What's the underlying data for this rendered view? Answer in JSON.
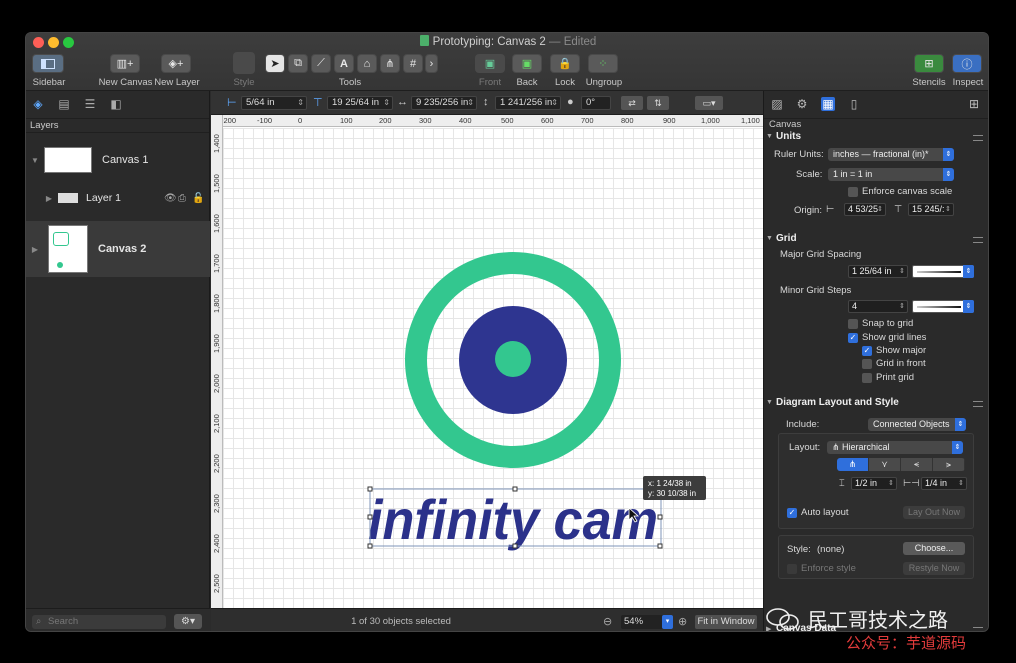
{
  "window": {
    "title": "Prototyping: Canvas 2",
    "edited": "— Edited"
  },
  "toolbar": {
    "sidebar_label": "Sidebar",
    "new_canvas_label": "New Canvas",
    "new_layer_label": "New Layer",
    "style_label": "Style",
    "tools_label": "Tools",
    "front_label": "Front",
    "back_label": "Back",
    "lock_label": "Lock",
    "ungroup_label": "Ungroup",
    "stencils_label": "Stencils",
    "inspect_label": "Inspect",
    "text_tool": "A"
  },
  "sidebar": {
    "header": "Layers",
    "canvas1": "Canvas 1",
    "layer1": "Layer 1",
    "canvas2": "Canvas 2",
    "search_placeholder": "Search"
  },
  "controls": {
    "x": "5/64 in",
    "y": "19 25/64 in",
    "width": "9 235/256 in",
    "height": "1 241/256 in",
    "angle": "0°"
  },
  "ruler": {
    "h": [
      "-200",
      "-100",
      "0",
      "100",
      "200",
      "300",
      "400",
      "500",
      "600",
      "700",
      "800",
      "900",
      "1,000",
      "1,100"
    ],
    "v": [
      "1,400",
      "1,500",
      "1,600",
      "1,700",
      "1,800",
      "1,900",
      "2,000",
      "2,100",
      "2,200",
      "2,300",
      "2,400",
      "2,500"
    ]
  },
  "canvas": {
    "logo_text": "infinity cam",
    "tooltip_x": "x: 1 24/38 in",
    "tooltip_y": "y: 30 10/38 in",
    "colors": {
      "ring": "#33c78f",
      "core": "#2e3590",
      "dot": "#33c78f",
      "text": "#2b318a"
    }
  },
  "status": {
    "message": "1 of 30 objects selected",
    "zoom": "54%",
    "fit_label": "Fit in Window"
  },
  "inspector": {
    "title": "Canvas",
    "units": {
      "header": "Units",
      "ruler_units_label": "Ruler Units:",
      "ruler_units_value": "inches — fractional (in)*",
      "scale_label": "Scale:",
      "scale_value": "1 in = 1 in",
      "enforce_label": "Enforce canvas scale",
      "origin_label": "Origin:",
      "origin_x": "4 53/25",
      "origin_y": "15 245/:"
    },
    "grid": {
      "header": "Grid",
      "major_label": "Major Grid Spacing",
      "major_value": "1 25/64 in",
      "minor_label": "Minor Grid Steps",
      "minor_value": "4",
      "snap": "Snap to grid",
      "show_lines": "Show grid lines",
      "show_major": "Show major",
      "in_front": "Grid in front",
      "print": "Print grid"
    },
    "layout": {
      "header": "Diagram Layout and Style",
      "include_label": "Include:",
      "include_value": "Connected Objects",
      "layout_label": "Layout:",
      "layout_value": "Hierarchical",
      "rank_sep": "1/2 in",
      "obj_sep": "1/4 in",
      "auto_layout": "Auto layout",
      "lay_out_now": "Lay Out Now",
      "style_label": "Style:",
      "style_value": "(none)",
      "choose": "Choose...",
      "enforce_style": "Enforce style",
      "restyle_now": "Restyle Now"
    },
    "canvas_data": {
      "header": "Canvas Data"
    }
  },
  "watermark": {
    "line1": "民工哥技术之路",
    "line2": "公众号：芋道源码"
  }
}
